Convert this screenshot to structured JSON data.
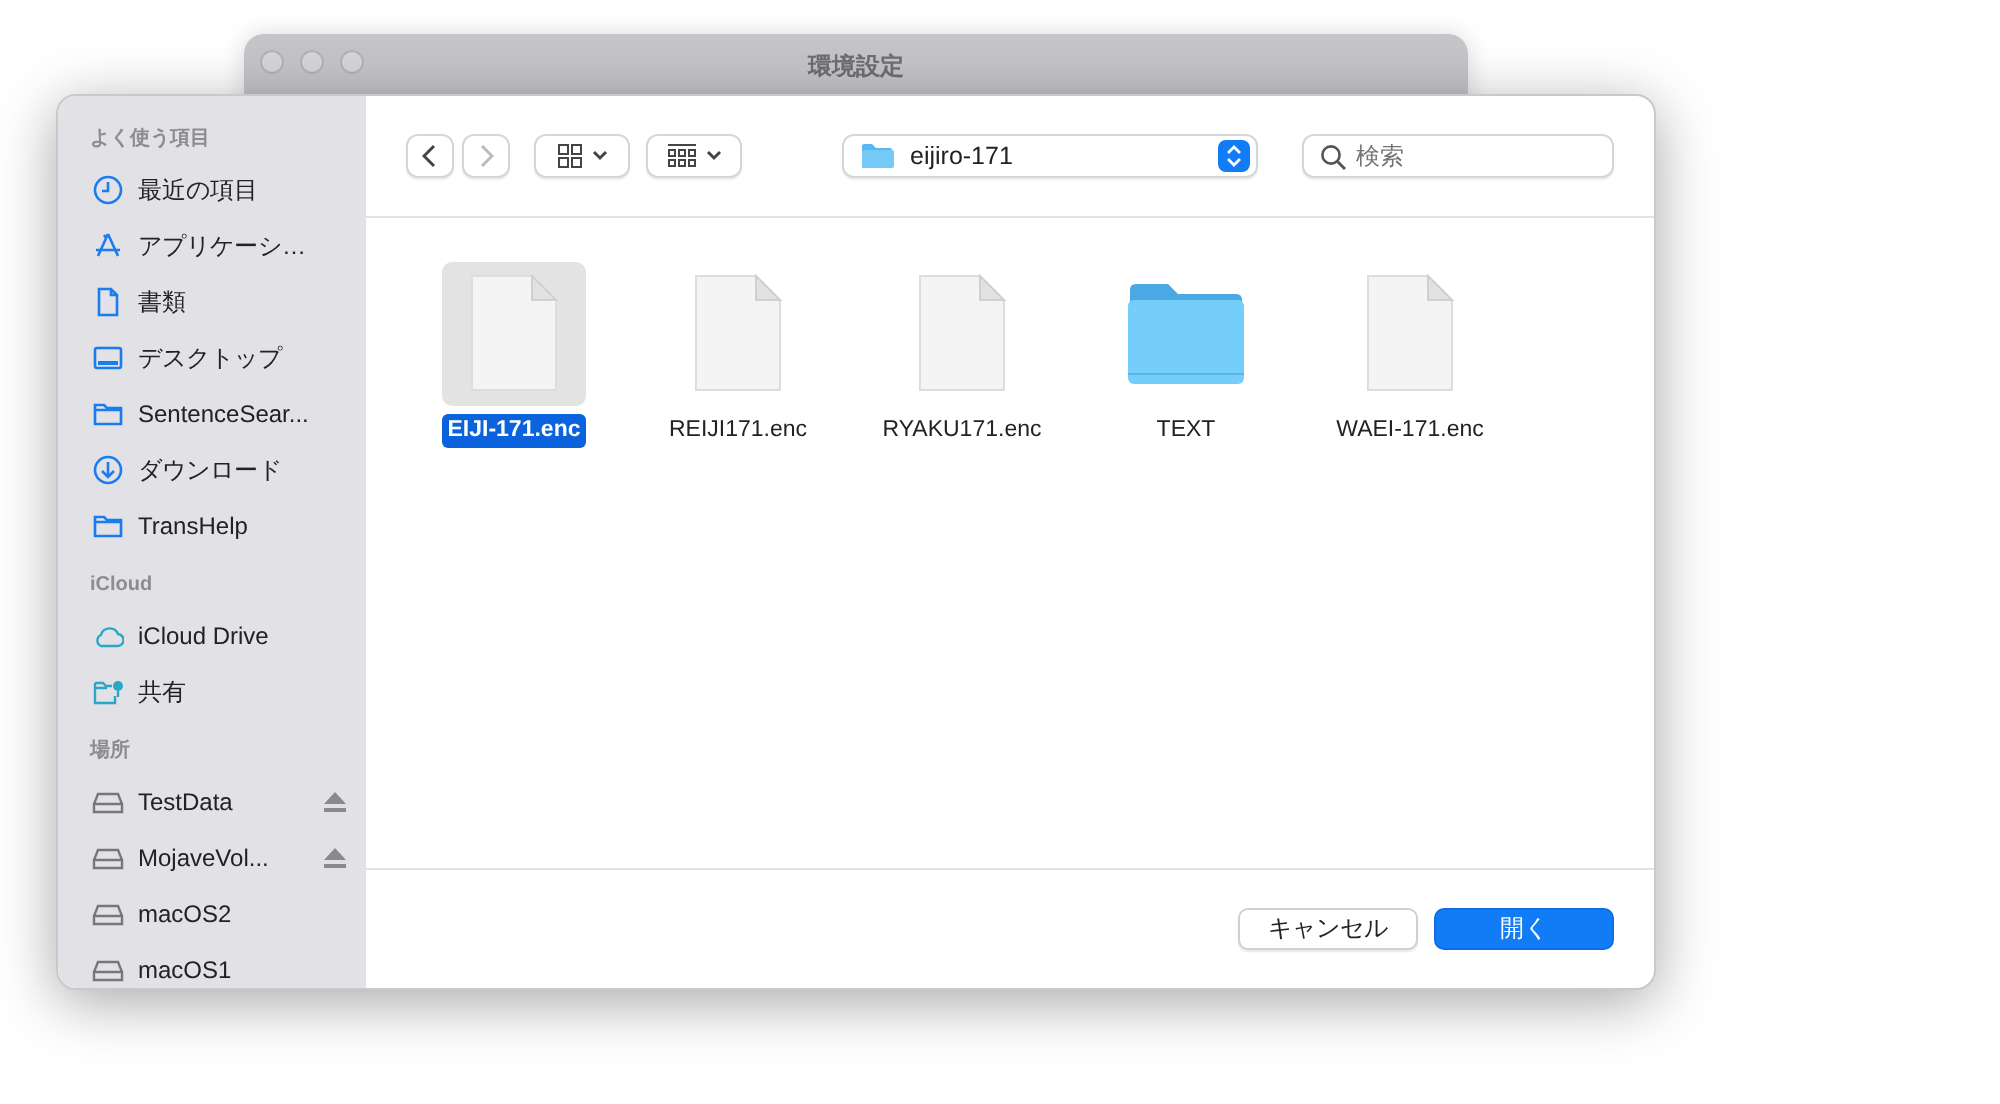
{
  "back_window": {
    "title": "環境設定"
  },
  "sidebar": {
    "sections": [
      {
        "title": "よく使う項目",
        "items": [
          {
            "kind": "clock",
            "label": "最近の項目",
            "eject": false
          },
          {
            "kind": "apps",
            "label": "アプリケーシ…",
            "eject": false
          },
          {
            "kind": "document",
            "label": "書類",
            "eject": false
          },
          {
            "kind": "desktop",
            "label": "デスクトップ",
            "eject": false
          },
          {
            "kind": "folder",
            "label": "SentenceSear...",
            "eject": false
          },
          {
            "kind": "download",
            "label": "ダウンロード",
            "eject": false
          },
          {
            "kind": "folder",
            "label": "TransHelp",
            "eject": false
          }
        ]
      },
      {
        "title": "iCloud",
        "items": [
          {
            "kind": "cloud",
            "label": "iCloud Drive",
            "eject": false
          },
          {
            "kind": "shared",
            "label": "共有",
            "eject": false
          }
        ]
      },
      {
        "title": "場所",
        "items": [
          {
            "kind": "drive",
            "label": "TestData",
            "eject": true
          },
          {
            "kind": "drive",
            "label": "MojaveVol...",
            "eject": true
          },
          {
            "kind": "drive",
            "label": "macOS2",
            "eject": false
          },
          {
            "kind": "drive",
            "label": "macOS1",
            "eject": false
          }
        ]
      }
    ]
  },
  "toolbar": {
    "location": "eijiro-171",
    "search": {
      "placeholder": "検索"
    }
  },
  "files": [
    {
      "kind": "file",
      "name": "EIJI-171.enc",
      "selected": true
    },
    {
      "kind": "file",
      "name": "REIJI171.enc",
      "selected": false
    },
    {
      "kind": "file",
      "name": "RYAKU171.enc",
      "selected": false
    },
    {
      "kind": "folder",
      "name": "TEXT",
      "selected": false
    },
    {
      "kind": "file",
      "name": "WAEI-171.enc",
      "selected": false
    }
  ],
  "buttons": [
    {
      "kind": "secondary",
      "label": "キャンセル"
    },
    {
      "kind": "primary",
      "label": "開く"
    }
  ]
}
